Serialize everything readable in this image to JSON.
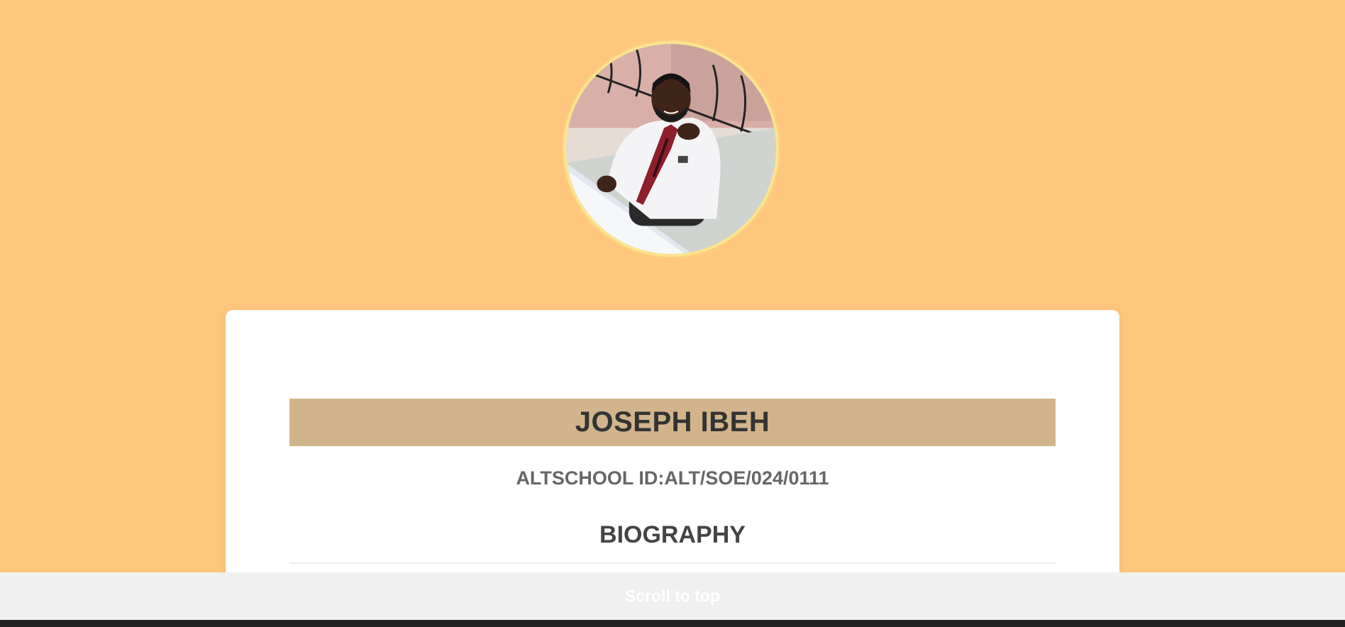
{
  "profile": {
    "photo_alt": "profile-photo",
    "name": "JOSEPH IBEH",
    "student_id": "ALTSCHOOL ID:ALT/SOE/024/0111"
  },
  "sections": {
    "biography_heading": "BIOGRAPHY"
  },
  "footer": {
    "scroll_to_top_label": "Scroll to top"
  },
  "colors": {
    "page_background": "#fec77d",
    "avatar_border": "#fbe48c",
    "name_banner": "#d2b48c",
    "card": "#ffffff",
    "footer_bar": "#f0f0f0"
  }
}
